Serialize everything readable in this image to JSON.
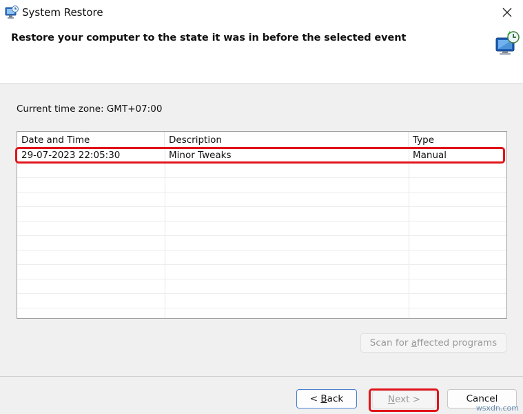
{
  "window": {
    "title": "System Restore",
    "close_glyph": "✕"
  },
  "header": {
    "heading": "Restore your computer to the state it was in before the selected event",
    "icon": "system-restore-monitor-icon"
  },
  "timezone_label": "Current time zone: GMT+07:00",
  "table": {
    "columns": [
      "Date and Time",
      "Description",
      "Type"
    ],
    "sort_glyph": "ˇ",
    "rows": [
      {
        "date": "29-07-2023 22:05:30",
        "description": "Minor Tweaks",
        "type": "Manual"
      }
    ]
  },
  "buttons": {
    "scan_pre": "Scan for ",
    "scan_u": "a",
    "scan_post": "ffected programs",
    "back_pre": "< ",
    "back_u": "B",
    "back_post": "ack",
    "next_u": "N",
    "next_post": "ext >",
    "cancel": "Cancel"
  },
  "watermark": "wsxdn.com",
  "colors": {
    "highlight": "#e0141a",
    "focus_border": "#4a7fd1"
  }
}
